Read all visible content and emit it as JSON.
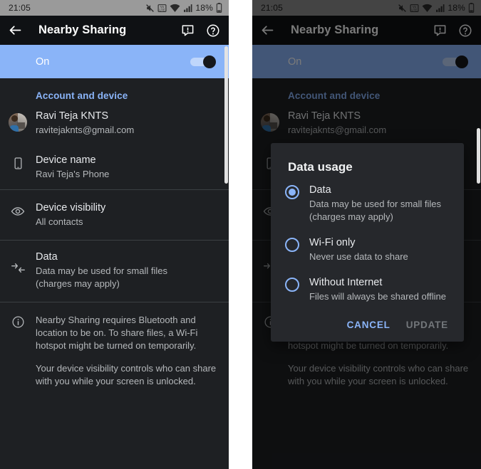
{
  "status_bar": {
    "time": "21:05",
    "battery_percent": "18%",
    "icons": [
      "mute-icon",
      "volte-icon",
      "wifi-icon",
      "signal-icon",
      "battery-icon"
    ]
  },
  "app_bar": {
    "back": "back-arrow-icon",
    "title": "Nearby Sharing",
    "feedback": "feedback-icon",
    "help": "help-icon"
  },
  "master_toggle": {
    "label": "On",
    "checked": true
  },
  "section": {
    "title": "Account and device"
  },
  "rows": [
    {
      "icon": "avatar",
      "title": "Ravi Teja KNTS",
      "sub": "ravitejaknts@gmail.com"
    },
    {
      "icon": "phone-icon",
      "title": "Device name",
      "sub": "Ravi Teja's Phone"
    },
    {
      "icon": "eye-icon",
      "title": "Device visibility",
      "sub": "All contacts"
    },
    {
      "icon": "data-transfer-icon",
      "title": "Data",
      "sub": "Data may be used for small files\n(charges may apply)"
    }
  ],
  "footnote": {
    "icon": "info-icon",
    "paragraph1": "Nearby Sharing requires Bluetooth and location to be on. To share files, a Wi-Fi hotspot might be turned on temporarily.",
    "paragraph2": "Your device visibility controls who can share with you while your screen is unlocked."
  },
  "dialog": {
    "title": "Data usage",
    "options": [
      {
        "label": "Data",
        "sub": "Data may be used for small files\n(charges may apply)",
        "selected": true
      },
      {
        "label": "Wi-Fi only",
        "sub": "Never use data to share",
        "selected": false
      },
      {
        "label": "Without Internet",
        "sub": "Files will always be shared offline",
        "selected": false
      }
    ],
    "cancel_label": "CANCEL",
    "update_label": "UPDATE"
  },
  "colors": {
    "accent_blue": "#8ab4f8",
    "toggle_bar_bg": "#8ab4f8",
    "app_bar_bg": "#0f1114",
    "page_bg": "#1e2023",
    "dialog_bg": "#26282c",
    "status_bar_bg": "#9a9a9a",
    "text_primary": "#e8eaed",
    "text_secondary": "#b5b8bb",
    "disabled_text": "#73777b"
  }
}
